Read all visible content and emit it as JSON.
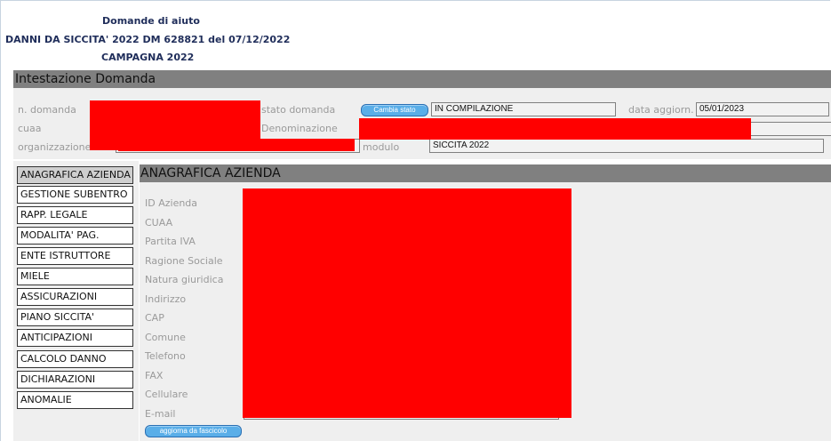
{
  "header": {
    "line1": "Domande di aiuto",
    "line2": "DANNI DA SICCITA' 2022 DM 628821 del 07/12/2022",
    "line3": "CAMPAGNA 2022"
  },
  "intestazione": {
    "section_title": "Intestazione Domanda",
    "labels": {
      "n_domanda": "n. domanda",
      "cuaa": "cuaa",
      "organizzazione": "organizzazione",
      "stato_domanda": "stato domanda",
      "denominazione": "Denominazione",
      "modulo": "modulo",
      "data_aggiorn": "data aggiorn."
    },
    "cambia_stato_label": "Cambia stato",
    "stato_value": "IN COMPILAZIONE",
    "data_value": "05/01/2023",
    "modulo_value": "SICCITA 2022"
  },
  "sidebar": {
    "items": [
      {
        "label": "ANAGRAFICA AZIENDA",
        "active": true
      },
      {
        "label": "GESTIONE SUBENTRO"
      },
      {
        "label": "RAPP. LEGALE"
      },
      {
        "label": "MODALITA' PAG."
      },
      {
        "label": "ENTE ISTRUTTORE"
      },
      {
        "label": "MIELE"
      },
      {
        "label": "ASSICURAZIONI"
      },
      {
        "label": "PIANO SICCITA'"
      },
      {
        "label": "ANTICIPAZIONI"
      },
      {
        "label": "CALCOLO DANNO"
      },
      {
        "label": "DICHIARAZIONI"
      },
      {
        "label": "ANOMALIE"
      }
    ]
  },
  "anagrafica": {
    "section_title": "ANAGRAFICA AZIENDA",
    "field_labels": [
      "ID Azienda",
      "CUAA",
      "Partita IVA",
      "Ragione Sociale",
      "Natura giuridica",
      "Indirizzo",
      "CAP",
      "Comune",
      "Telefono",
      "FAX",
      "Cellulare",
      "E-mail"
    ],
    "aggiorna_label": "aggiorna da fascicolo"
  },
  "colors": {
    "header_bar": "#808080",
    "panel_bg": "#efefef",
    "redaction": "#ff0000",
    "button_blue": "#5aaee8",
    "title_text": "#1f2d5a"
  }
}
